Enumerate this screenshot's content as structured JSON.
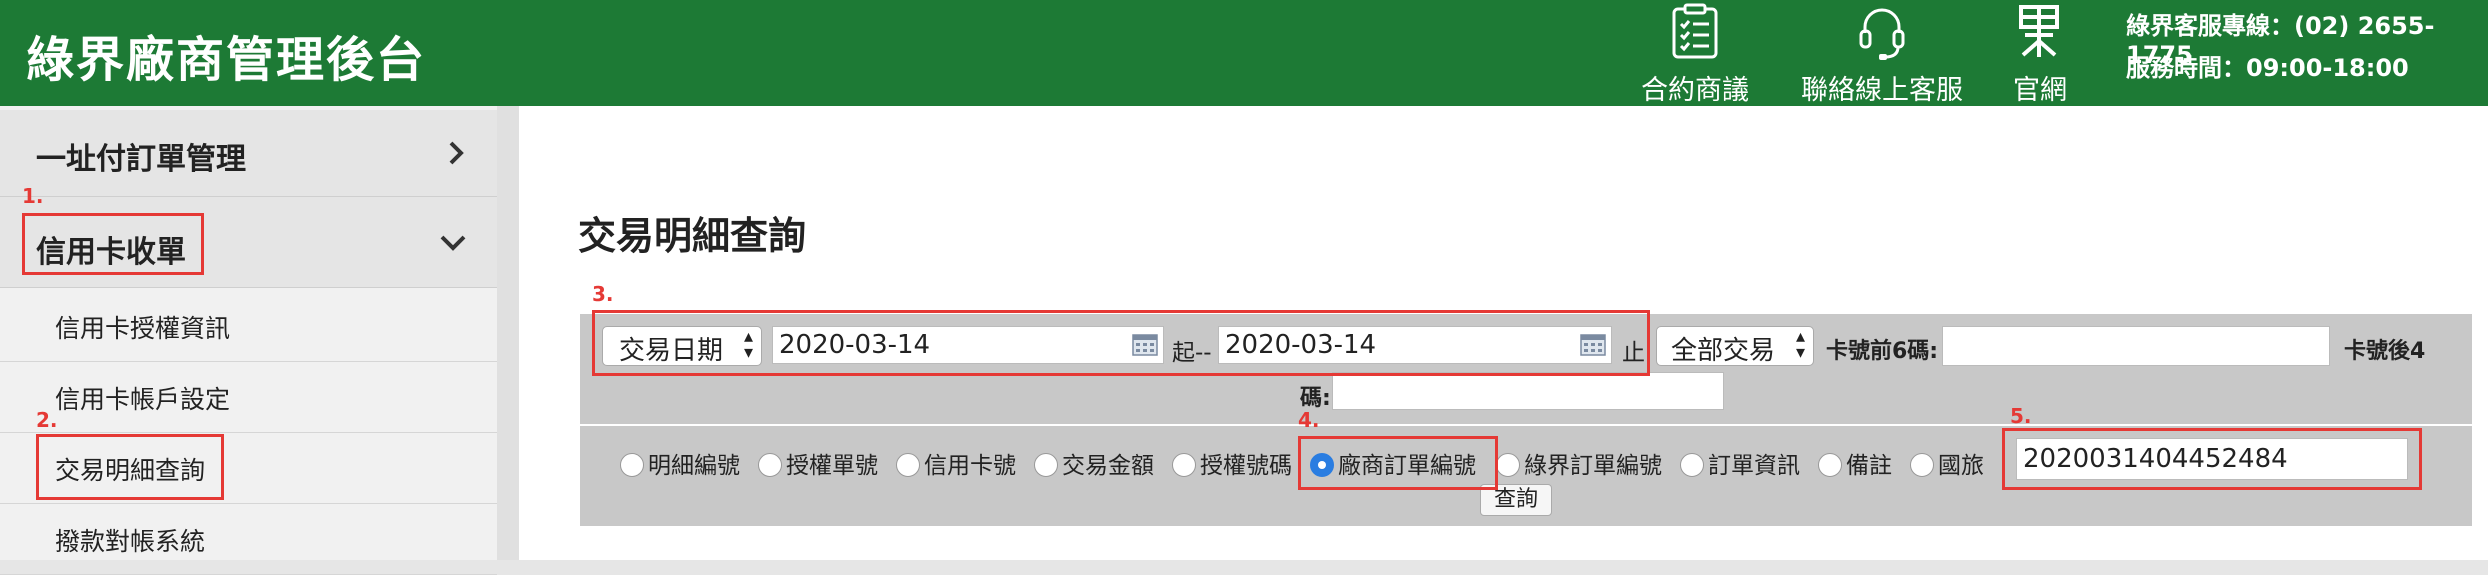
{
  "header": {
    "app_title": "綠界廠商管理後台",
    "nav": [
      {
        "label": "合約商議",
        "icon": "contract-checklist-icon"
      },
      {
        "label": "聯絡線上客服",
        "icon": "headset-icon"
      },
      {
        "label": "官網",
        "icon": "ecpay-logo-icon"
      }
    ],
    "service_phone": "綠界客服專線：(02) 2655-1775",
    "service_hours": "服務時間：09:00-18:00"
  },
  "sidebar": {
    "menus": [
      {
        "label": "一址付訂單管理",
        "icon": "chevron-right-icon"
      },
      {
        "label": "信用卡收單",
        "icon": "chevron-down-icon"
      }
    ],
    "sub_items": [
      "信用卡授權資訊",
      "信用卡帳戶設定",
      "交易明細查詢",
      "撥款對帳系統"
    ]
  },
  "main": {
    "page_title": "交易明細查詢",
    "date_type": "交易日期",
    "date_from": "2020-03-14",
    "from_label": "起--",
    "date_to": "2020-03-14",
    "to_label": "止",
    "txn_type": "全部交易",
    "card_first6_label": "卡號前6碼:",
    "card_first6_value": "",
    "card_last4_label": "卡號後4",
    "card_last4_label2": "碼:",
    "card_last4_value": "",
    "radios": [
      {
        "label": "明細編號",
        "checked": false
      },
      {
        "label": "授權單號",
        "checked": false
      },
      {
        "label": "信用卡號",
        "checked": false
      },
      {
        "label": "交易金額",
        "checked": false
      },
      {
        "label": "授權號碼",
        "checked": false
      },
      {
        "label": "廠商訂單編號",
        "checked": true
      },
      {
        "label": "綠界訂單編號",
        "checked": false
      },
      {
        "label": "訂單資訊",
        "checked": false
      },
      {
        "label": "備註",
        "checked": false
      },
      {
        "label": "國旅",
        "checked": false
      }
    ],
    "radio_separator": "|",
    "search_value": "2020031404452484",
    "query_button": "查詢"
  },
  "annotations": [
    "1.",
    "2.",
    "3.",
    "4.",
    "5."
  ],
  "colors": {
    "header_green": "#1d7a35",
    "annotation_red": "#e53935",
    "radio_selected": "#2a7de1"
  }
}
